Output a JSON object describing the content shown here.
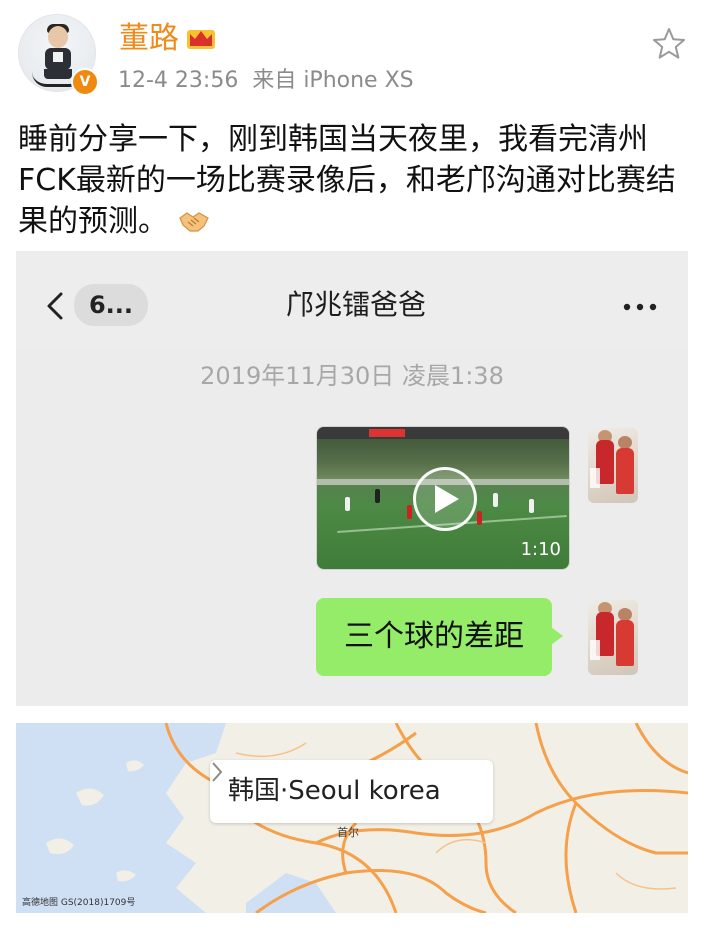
{
  "header": {
    "username": "董路",
    "avatar_badge": "V",
    "timestamp": "12-4 23:56",
    "source": "来自 iPhone XS",
    "colors": {
      "username": "#ef8a1b",
      "badge": "#f08a0f",
      "meta": "#8b8b8b"
    },
    "icons": [
      "crown-icon",
      "verified-badge-icon",
      "star-favorite-icon"
    ]
  },
  "post": {
    "text": "睡前分享一下，刚到韩国当天夜里，我看完清州FCK最新的一场比赛录像后，和老邝沟通对比赛结果的预测。",
    "emoji": "handshake-emoji"
  },
  "chat": {
    "back_label": "6...",
    "title": "邝兆镭爸爸",
    "timestamp": "2019年11月30日 凌晨1:38",
    "video": {
      "duration": "1:10"
    },
    "message": "三个球的差距",
    "bubble_color": "#95ec69",
    "icons": [
      "back-chevron-icon",
      "more-icon",
      "play-icon"
    ]
  },
  "map": {
    "location_label": "韩国·Seoul korea",
    "city_label": "首尔",
    "credit": "高德地图 GS(2018)1709号",
    "icons": [
      "chevron-right-icon"
    ]
  }
}
